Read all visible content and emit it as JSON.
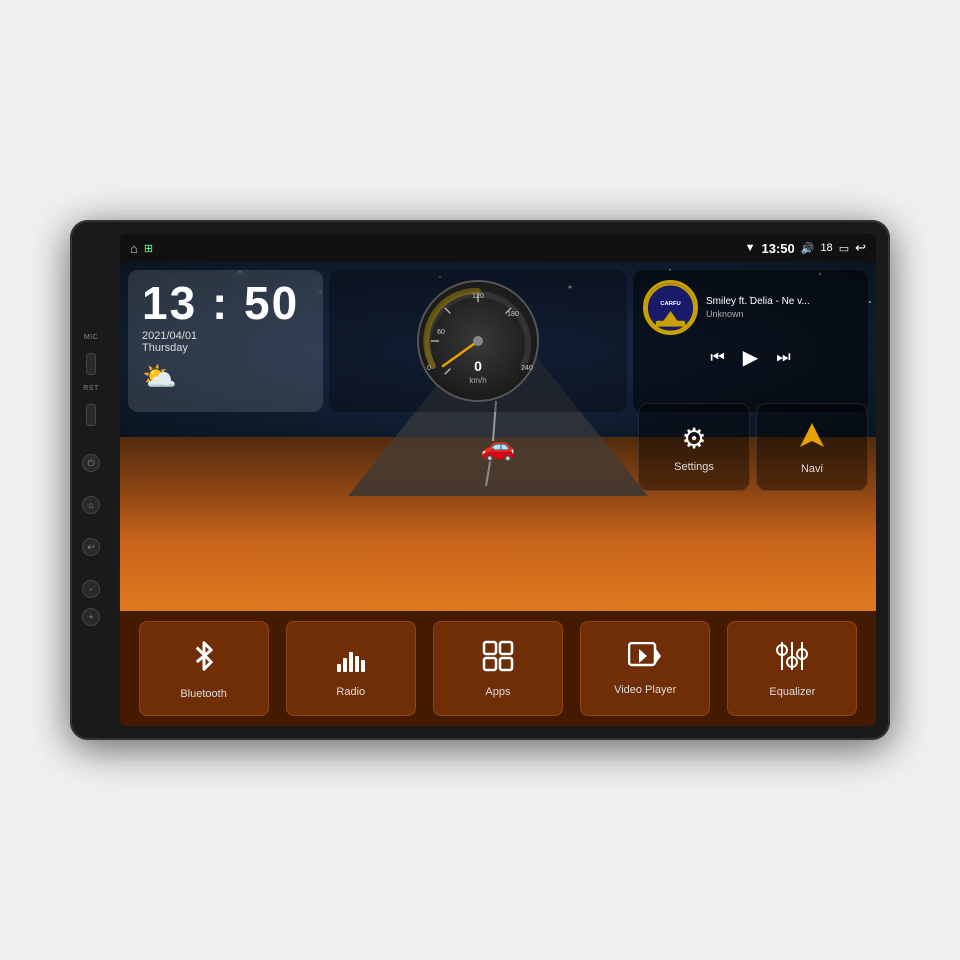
{
  "device": {
    "side_labels": [
      "MIC",
      "RST"
    ]
  },
  "status_bar": {
    "home_icon": "⌂",
    "apps_icon": "⊞",
    "wifi_icon": "▼",
    "time": "13:50",
    "volume_icon": "🔊",
    "volume_level": "18",
    "battery_icon": "▭",
    "back_icon": "↩"
  },
  "clock_widget": {
    "time": "13 : 50",
    "date": "2021/04/01",
    "day": "Thursday",
    "weather_icon": "⛅"
  },
  "music_widget": {
    "title": "Smiley ft. Delia - Ne v...",
    "artist": "Unknown",
    "prev_icon": "⏮",
    "play_icon": "▶",
    "next_icon": "⏭"
  },
  "quick_buttons": [
    {
      "id": "settings",
      "label": "Settings",
      "icon": "⚙"
    },
    {
      "id": "navi",
      "label": "Navi",
      "icon": "▲"
    }
  ],
  "bottom_items": [
    {
      "id": "bluetooth",
      "label": "Bluetooth",
      "icon": "bluetooth"
    },
    {
      "id": "radio",
      "label": "Radio",
      "icon": "radio"
    },
    {
      "id": "apps",
      "label": "Apps",
      "icon": "apps"
    },
    {
      "id": "video-player",
      "label": "Video Player",
      "icon": "video"
    },
    {
      "id": "equalizer",
      "label": "Equalizer",
      "icon": "equalizer"
    }
  ],
  "speedometer": {
    "speed": "0",
    "unit": "km/h",
    "max": 240
  }
}
